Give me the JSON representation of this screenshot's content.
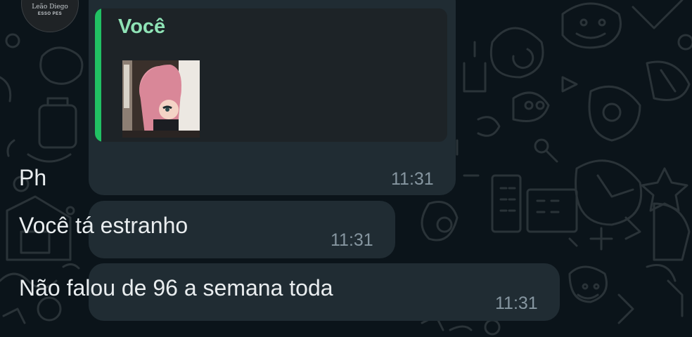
{
  "avatar": {
    "name": "Leão Diego",
    "subtitle": "ESSO PES"
  },
  "messages": [
    {
      "reply": {
        "author": "Você",
        "attachment_icon": "image-thumbnail"
      },
      "text": "Ph",
      "time": "11:31"
    },
    {
      "text": "Você tá estranho",
      "time": "11:31"
    },
    {
      "text": "Não falou de 96 a semana toda",
      "time": "11:31"
    }
  ],
  "colors": {
    "background": "#0b141a",
    "bubble": "#202c33",
    "quote_bar": "#21c063",
    "quote_author": "#8fe3b6",
    "text": "#e9edef",
    "timestamp": "#8696a0"
  }
}
